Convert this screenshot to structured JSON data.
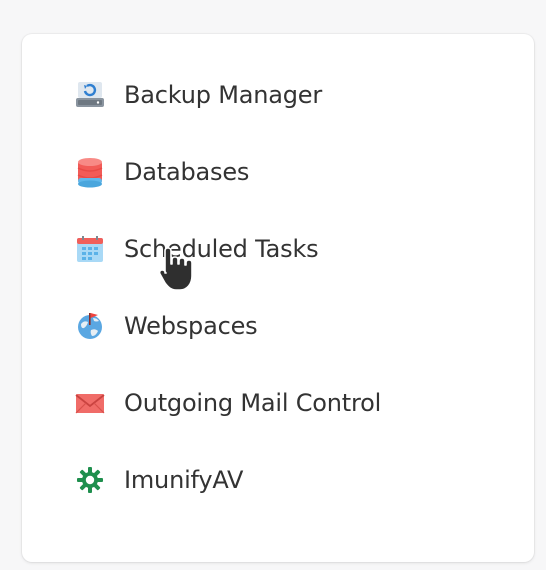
{
  "menu": {
    "items": [
      {
        "label": "Backup Manager",
        "icon": "backup-drive-icon"
      },
      {
        "label": "Databases",
        "icon": "database-icon"
      },
      {
        "label": "Scheduled Tasks",
        "icon": "calendar-icon"
      },
      {
        "label": "Webspaces",
        "icon": "globe-icon"
      },
      {
        "label": "Outgoing Mail Control",
        "icon": "mail-envelope-icon"
      },
      {
        "label": "ImunifyAV",
        "icon": "imunify-shield-icon"
      }
    ]
  },
  "colors": {
    "card_background": "#ffffff",
    "page_background": "#f7f7f8",
    "text": "#333333",
    "database": "#f25b57",
    "calendar": "#60b8ea",
    "mail": "#e85c58",
    "imunify": "#1f8f4e"
  },
  "cursor": {
    "type": "hand-pointer"
  }
}
